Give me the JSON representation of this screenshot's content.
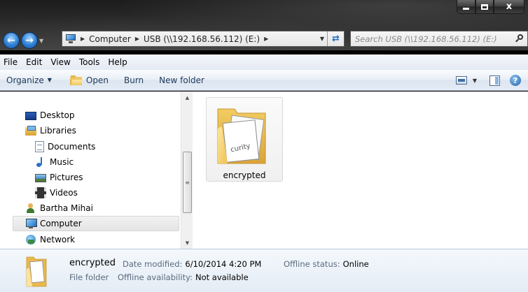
{
  "window": {
    "controls": {
      "minimize": "minimize",
      "maximize": "maximize",
      "close": "close"
    }
  },
  "address": {
    "crumbs": [
      "Computer",
      "USB (\\\\192.168.56.112) (E:)"
    ]
  },
  "search": {
    "placeholder": "Search USB (\\\\192.168.56.112) (E:)"
  },
  "menu": [
    "File",
    "Edit",
    "View",
    "Tools",
    "Help"
  ],
  "toolbar": {
    "organize": "Organize",
    "open": "Open",
    "burn": "Burn",
    "new_folder": "New folder"
  },
  "nav": {
    "desktop": "Desktop",
    "libraries": "Libraries",
    "documents": "Documents",
    "music": "Music",
    "pictures": "Pictures",
    "videos": "Videos",
    "user": "Bartha Mihai",
    "computer": "Computer",
    "network": "Network",
    "selected": "Computer"
  },
  "content": {
    "items": [
      {
        "name": "encrypted",
        "type": "folder",
        "paper_text": "curity"
      }
    ]
  },
  "details": {
    "name": "encrypted",
    "type": "File folder",
    "date_modified_label": "Date modified:",
    "date_modified": "6/10/2014 4:20 PM",
    "offline_availability_label": "Offline availability:",
    "offline_availability": "Not available",
    "offline_status_label": "Offline status:",
    "offline_status": "Online"
  },
  "colors": {
    "accent": "#1e395b",
    "folder_yellow": "#f1c75e",
    "title_glass": "#2b2b2b"
  }
}
